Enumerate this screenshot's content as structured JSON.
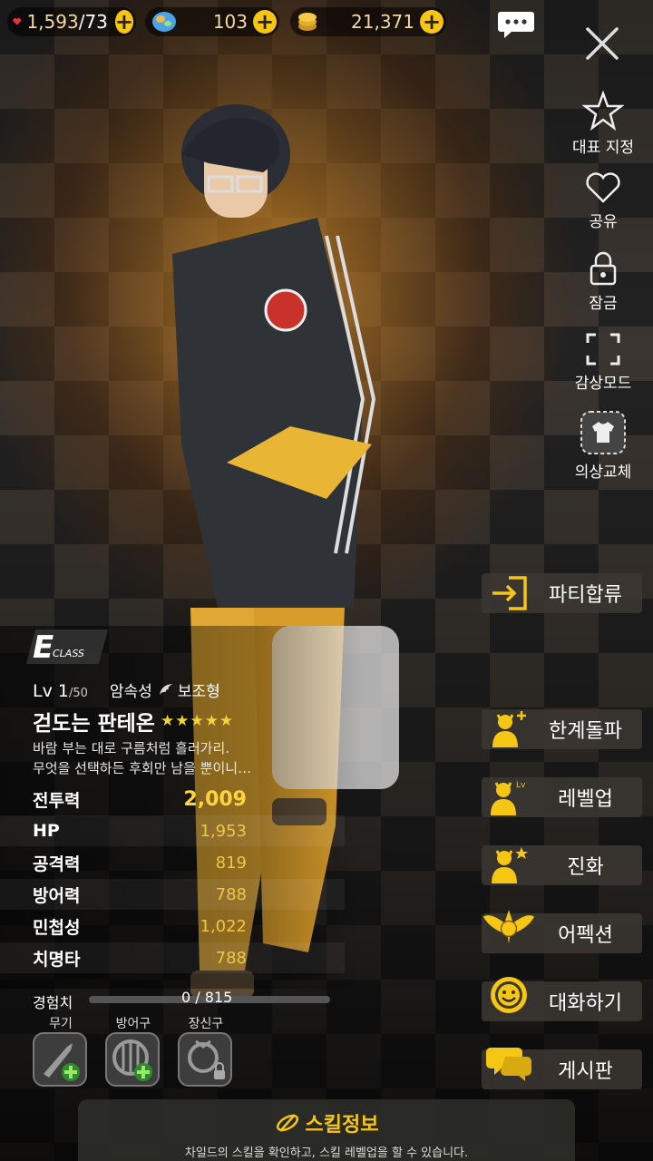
{
  "top_bar": {
    "hearts": {
      "icon": "heart-icon",
      "value": "1,593",
      "max": "/73"
    },
    "gems": {
      "icon": "gem-icon",
      "value": "103"
    },
    "gold": {
      "icon": "gold-coin-icon",
      "value": "21,371"
    }
  },
  "side_menu": [
    {
      "icon": "star-outline-icon",
      "label": "대표 지정"
    },
    {
      "icon": "heart-outline-icon",
      "label": "공유"
    },
    {
      "icon": "lock-icon",
      "label": "잠금"
    },
    {
      "icon": "fullscreen-icon",
      "label": "감상모드"
    },
    {
      "icon": "costume-icon",
      "label": "의상교체"
    }
  ],
  "actions": [
    {
      "icon": "enter-party-icon",
      "label": "파티합류"
    },
    {
      "icon": "limit-break-icon",
      "label": "한계돌파"
    },
    {
      "icon": "level-up-icon",
      "label": "레벨업"
    },
    {
      "icon": "evolve-icon",
      "label": "진화"
    },
    {
      "icon": "affection-icon",
      "label": "어펙션"
    },
    {
      "icon": "chat-smile-icon",
      "label": "대화하기"
    },
    {
      "icon": "board-icon",
      "label": "게시판"
    }
  ],
  "character": {
    "class_letter": "E",
    "class_word": "CLASS",
    "level": "Lv 1",
    "level_max": "/50",
    "element": "암속성",
    "role": "보조형",
    "name": "걷도는 판테온",
    "stars": "★★★★★",
    "description_line1": "바람 부는 대로 구름처럼 흘러가리.",
    "description_line2": "무엇을 선택하든 후회만 남을 뿐이니…"
  },
  "stats": [
    {
      "label": "전투력",
      "value": "2,009"
    },
    {
      "label": "HP",
      "value": "1,953"
    },
    {
      "label": "공격력",
      "value": "819"
    },
    {
      "label": "방어력",
      "value": "788"
    },
    {
      "label": "민첩성",
      "value": "1,022"
    },
    {
      "label": "치명타",
      "value": "788"
    }
  ],
  "experience": {
    "label": "경험치",
    "value": "0 / 815",
    "progress": 0
  },
  "equipment": [
    {
      "label": "무기",
      "icon": "weapon-knife-icon",
      "state": "add"
    },
    {
      "label": "방어구",
      "icon": "armor-shield-icon",
      "state": "add"
    },
    {
      "label": "장신구",
      "icon": "accessory-ring-icon",
      "state": "locked"
    }
  ],
  "skill_info": {
    "icon": "skill-icon",
    "title": "스킬정보",
    "subtitle": "차일드의 스킬을 확인하고, 스킬 레벨업을 할 수 있습니다."
  },
  "colors": {
    "accent": "#f6c615",
    "stat_value": "#f0c64a"
  }
}
